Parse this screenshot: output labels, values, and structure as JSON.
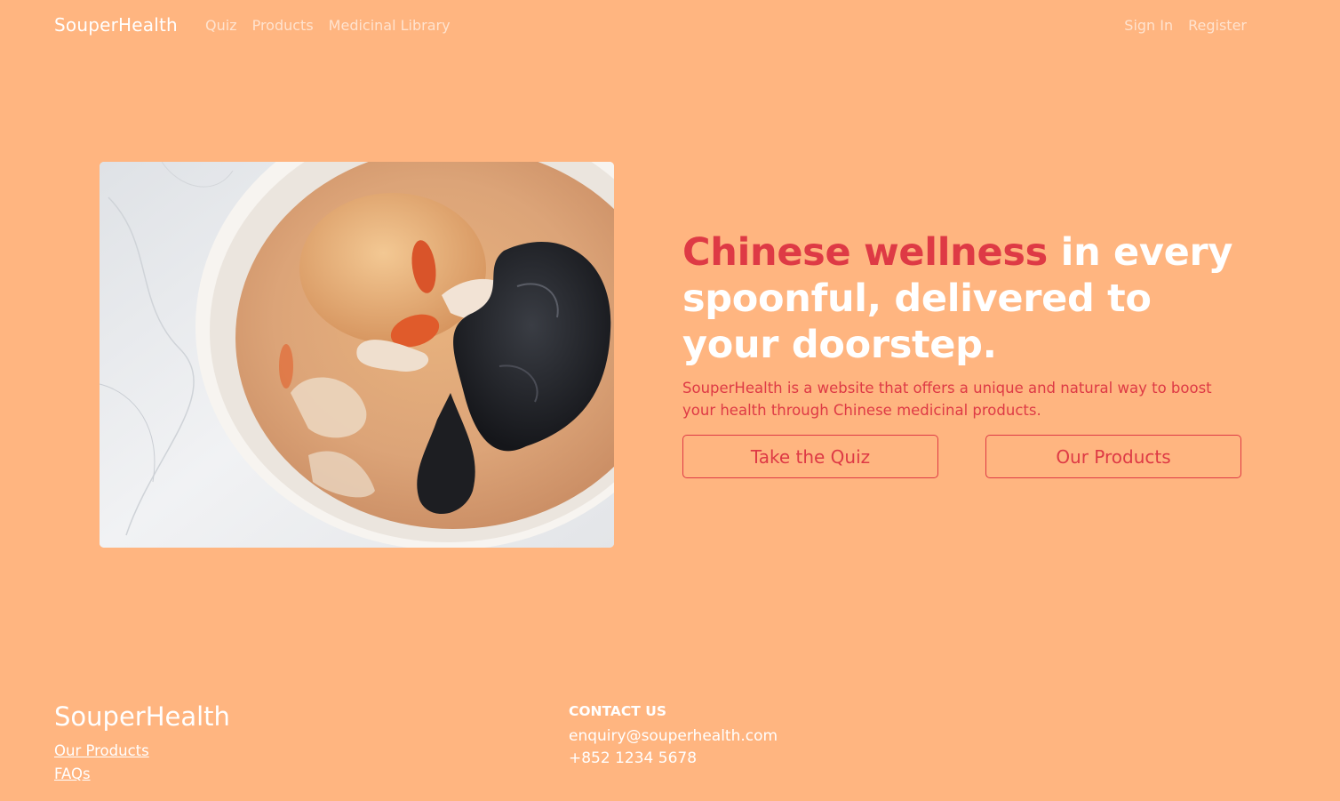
{
  "nav": {
    "brand": "SouperHealth",
    "links": [
      "Quiz",
      "Products",
      "Medicinal Library"
    ],
    "auth": [
      "Sign In",
      "Register"
    ]
  },
  "hero": {
    "headline_accent": "Chinese wellness",
    "headline_rest": " in every spoonful, delivered to your doorstep.",
    "lead": "SouperHealth is a website that offers a unique and natural way to boost your health through Chinese medicinal products.",
    "buttons": {
      "quiz": "Take the Quiz",
      "products": "Our Products"
    },
    "image_alt": "Bowl of Chinese herbal soup with goji berries, cashews and wood ear mushroom"
  },
  "footer": {
    "brand": "SouperHealth",
    "links": [
      "Our Products",
      "FAQs"
    ],
    "contact": {
      "heading": "CONTACT US",
      "email": "enquiry@souperhealth.com",
      "phone": "+852 1234 5678"
    }
  },
  "colors": {
    "background": "#FFB580",
    "accent": "#DE3A45",
    "text": "#FFFFFF"
  }
}
